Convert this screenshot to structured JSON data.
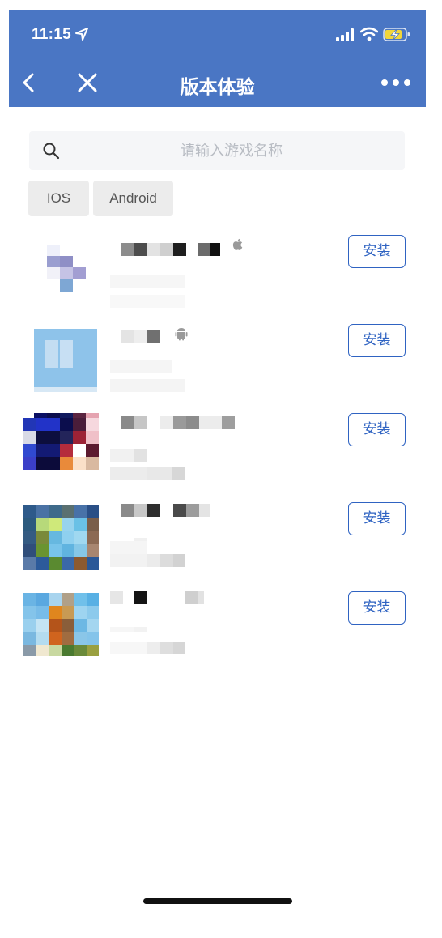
{
  "status_bar": {
    "time": "11:15"
  },
  "nav": {
    "title": "版本体验"
  },
  "search": {
    "placeholder": "请输入游戏名称",
    "value": ""
  },
  "filters": [
    {
      "label": "IOS"
    },
    {
      "label": "Android"
    }
  ],
  "apps": [
    {
      "platform_icon": "apple-icon",
      "install_label": "安装"
    },
    {
      "platform_icon": "android-icon",
      "install_label": "安装"
    },
    {
      "install_label": "安装"
    },
    {
      "install_label": "安装"
    },
    {
      "install_label": "安装"
    }
  ],
  "colors": {
    "header": "#4a76c4",
    "accent": "#2f63c2"
  }
}
